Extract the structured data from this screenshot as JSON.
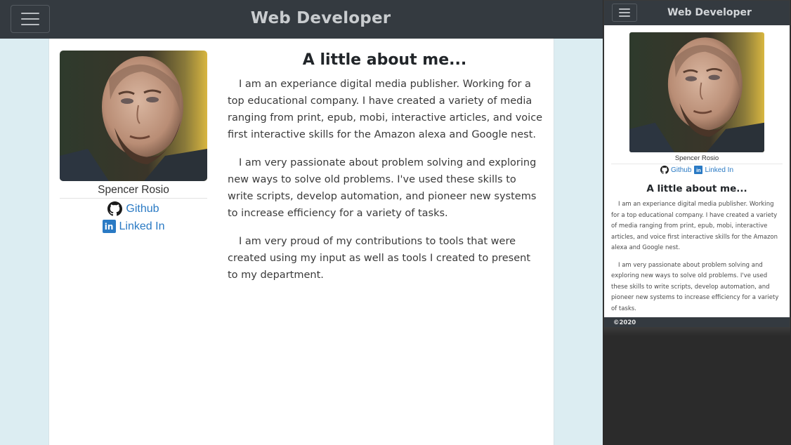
{
  "desktop": {
    "brand": "Web Developer",
    "profile": {
      "name": "Spencer Rosio",
      "github_label": "Github",
      "linkedin_label": "Linked In"
    },
    "about": {
      "heading": "A little about me...",
      "paragraphs": [
        "I am an experiance digital media publisher. Working for a top educational company. I have created a variety of media ranging from print, epub, mobi, interactive articles, and voice first interactive skills for the Amazon alexa and Google nest.",
        "I am very passionate about problem solving and exploring new ways to solve old problems. I've used these skills to write scripts, develop automation, and pioneer new systems to increase efficiency for a variety of tasks.",
        "I am very proud of my contributions to tools that were created using my input as well as tools I created to present to my department."
      ]
    }
  },
  "mobile": {
    "brand": "Web Developer",
    "profile": {
      "name": "Spencer Rosio",
      "github_label": "Github",
      "linkedin_label": "Linked In"
    },
    "about": {
      "heading": "A little about me...",
      "paragraphs": [
        "I am an experiance digital media publisher. Working for a top educational company. I have created a variety of media ranging from print, epub, mobi, interactive articles, and voice first interactive skills for the Amazon alexa and Google nest.",
        "I am very passionate about problem solving and exploring new ways to solve old problems. I've used these skills to write scripts, develop automation, and pioneer new systems to increase efficiency for a variety of tasks."
      ]
    },
    "footer": "©2020"
  },
  "colors": {
    "navbar": "#343a40",
    "page_bg": "#dcedf2",
    "link": "#2a7ac4"
  },
  "icons": [
    "hamburger-menu-icon",
    "github-icon",
    "linkedin-icon"
  ]
}
